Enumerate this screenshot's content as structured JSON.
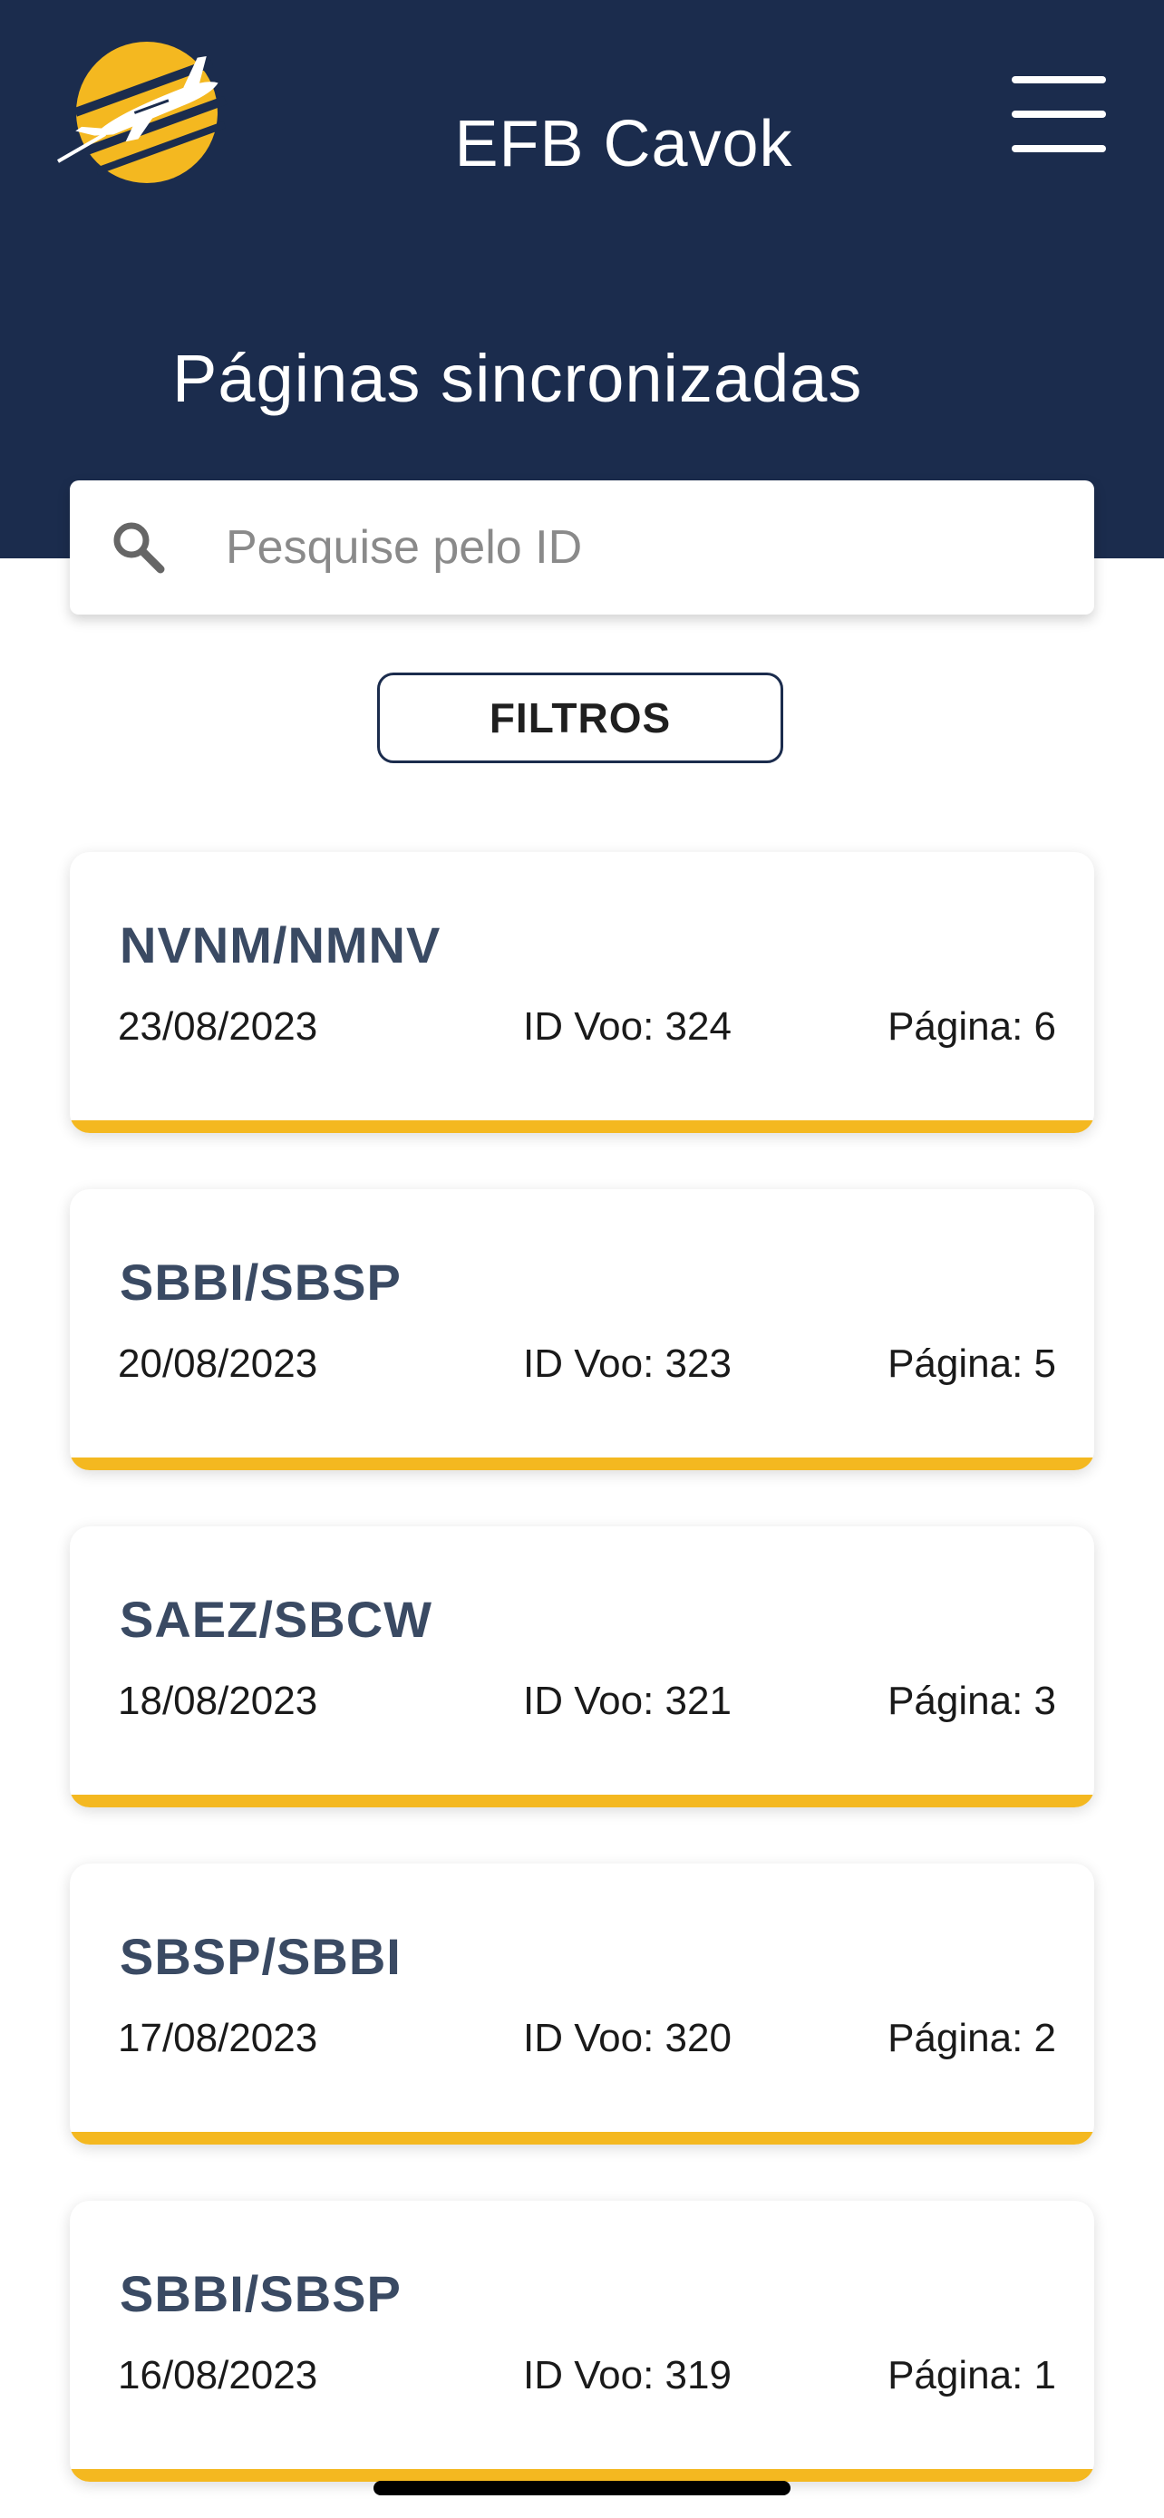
{
  "header": {
    "app_title": "EFB Cavok",
    "page_title": "Páginas sincronizadas",
    "background_color": "#1b2c4d",
    "logo_icon": "airplane-logo-icon",
    "menu_icon": "hamburger-menu-icon"
  },
  "search": {
    "placeholder": "Pesquise pelo ID",
    "value": "",
    "icon": "search-icon"
  },
  "filters": {
    "label": "FILTROS"
  },
  "accent_color": "#f4b820",
  "cards": [
    {
      "route": "NVNM/NMNV",
      "date": "23/08/2023",
      "flight_id": "ID Voo: 324",
      "page": "Página: 6"
    },
    {
      "route": "SBBI/SBSP",
      "date": "20/08/2023",
      "flight_id": "ID Voo: 323",
      "page": "Página: 5"
    },
    {
      "route": "SAEZ/SBCW",
      "date": "18/08/2023",
      "flight_id": "ID Voo: 321",
      "page": "Página: 3"
    },
    {
      "route": "SBSP/SBBI",
      "date": "17/08/2023",
      "flight_id": "ID Voo: 320",
      "page": "Página: 2"
    },
    {
      "route": "SBBI/SBSP",
      "date": "16/08/2023",
      "flight_id": "ID Voo: 319",
      "page": "Página: 1"
    }
  ]
}
